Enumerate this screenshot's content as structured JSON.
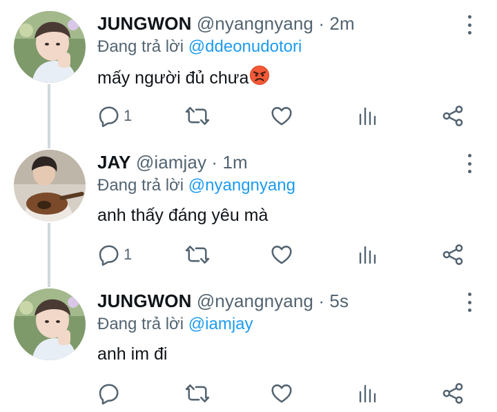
{
  "tweets": [
    {
      "display_name": "JUNGWON",
      "handle": "@nyangnyang",
      "separator": "·",
      "time": "2m",
      "reply_prefix": "Đang trả lời",
      "reply_to": "@ddeonudotori",
      "text": "mấy người đủ chưa",
      "emoji": "angry-face-icon",
      "reply_count": "1"
    },
    {
      "display_name": "JAY",
      "handle": "@iamjay",
      "separator": "·",
      "time": "1m",
      "reply_prefix": "Đang trả lời",
      "reply_to": "@nyangnyang",
      "text": "anh thấy đáng yêu mà",
      "reply_count": "1"
    },
    {
      "display_name": "JUNGWON",
      "handle": "@nyangnyang",
      "separator": "·",
      "time": "5s",
      "reply_prefix": "Đang trả lời",
      "reply_to": "@iamjay",
      "text": "anh im đi",
      "reply_count": ""
    }
  ],
  "colors": {
    "text": "#0f1419",
    "secondary": "#536471",
    "link": "#1d9bf0",
    "thread_line": "#cfd9de"
  }
}
